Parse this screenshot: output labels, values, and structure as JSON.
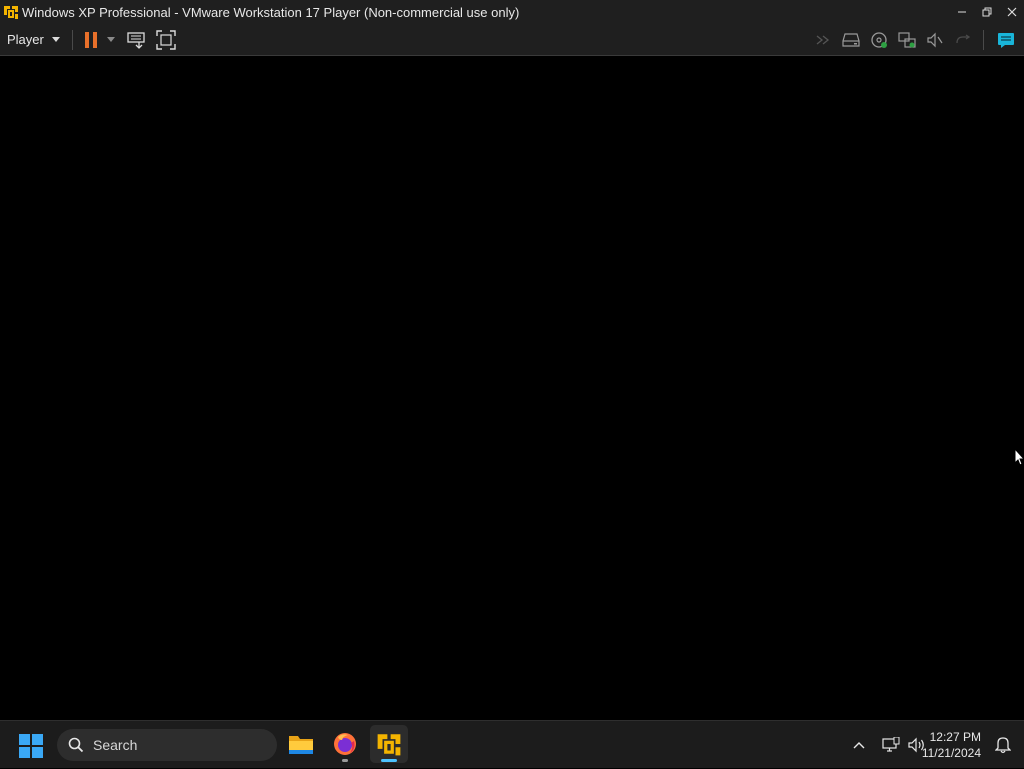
{
  "window": {
    "title": "Windows XP Professional - VMware Workstation 17 Player (Non-commercial use only)",
    "controls": [
      "minimize-icon",
      "restore-icon",
      "close-icon"
    ]
  },
  "toolbar": {
    "player_menu_label": "Player",
    "left_icons": [
      "pause-icon",
      "dropdown-arrow-icon",
      "send-ctrl-alt-del-icon",
      "fullscreen-icon"
    ],
    "right_icons": [
      "forward-icon",
      "hard-disk-icon",
      "cd-dvd-icon",
      "network-adapter-icon",
      "sound-icon",
      "usb-icon",
      "message-log-icon"
    ],
    "accent_color": "#e8702a",
    "message_icon_color": "#19b5d9"
  },
  "taskbar": {
    "search_placeholder": "Search",
    "apps": [
      "file-explorer-icon",
      "firefox-icon",
      "vmware-player-icon"
    ],
    "tray": [
      "chevron-up-icon",
      "network-icon",
      "volume-icon",
      "notification-bell-icon"
    ],
    "time": "12:27 PM",
    "date": "11/21/2024",
    "active_indicator_color": "#4cc2ff"
  }
}
